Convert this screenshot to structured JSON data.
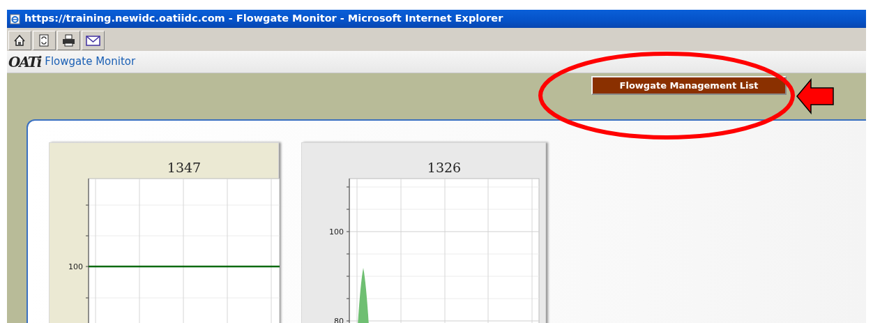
{
  "window": {
    "title": "https://training.newidc.oatiidc.com - Flowgate Monitor - Microsoft Internet Explorer"
  },
  "toolbar": {
    "buttons": [
      {
        "kind": "home"
      },
      {
        "kind": "refresh"
      },
      {
        "kind": "print"
      },
      {
        "kind": "mail"
      }
    ]
  },
  "app_header": {
    "logo": "OATi",
    "title": "Flowgate Monitor"
  },
  "action_button": {
    "label": "Flowgate Management List"
  },
  "charts": [
    {
      "title": "1347",
      "kind": "flat",
      "selected": true,
      "y_tick_labels": [
        "100"
      ]
    },
    {
      "title": "1326",
      "kind": "spike",
      "selected": false,
      "y_tick_labels": [
        "100",
        "80"
      ]
    }
  ]
}
